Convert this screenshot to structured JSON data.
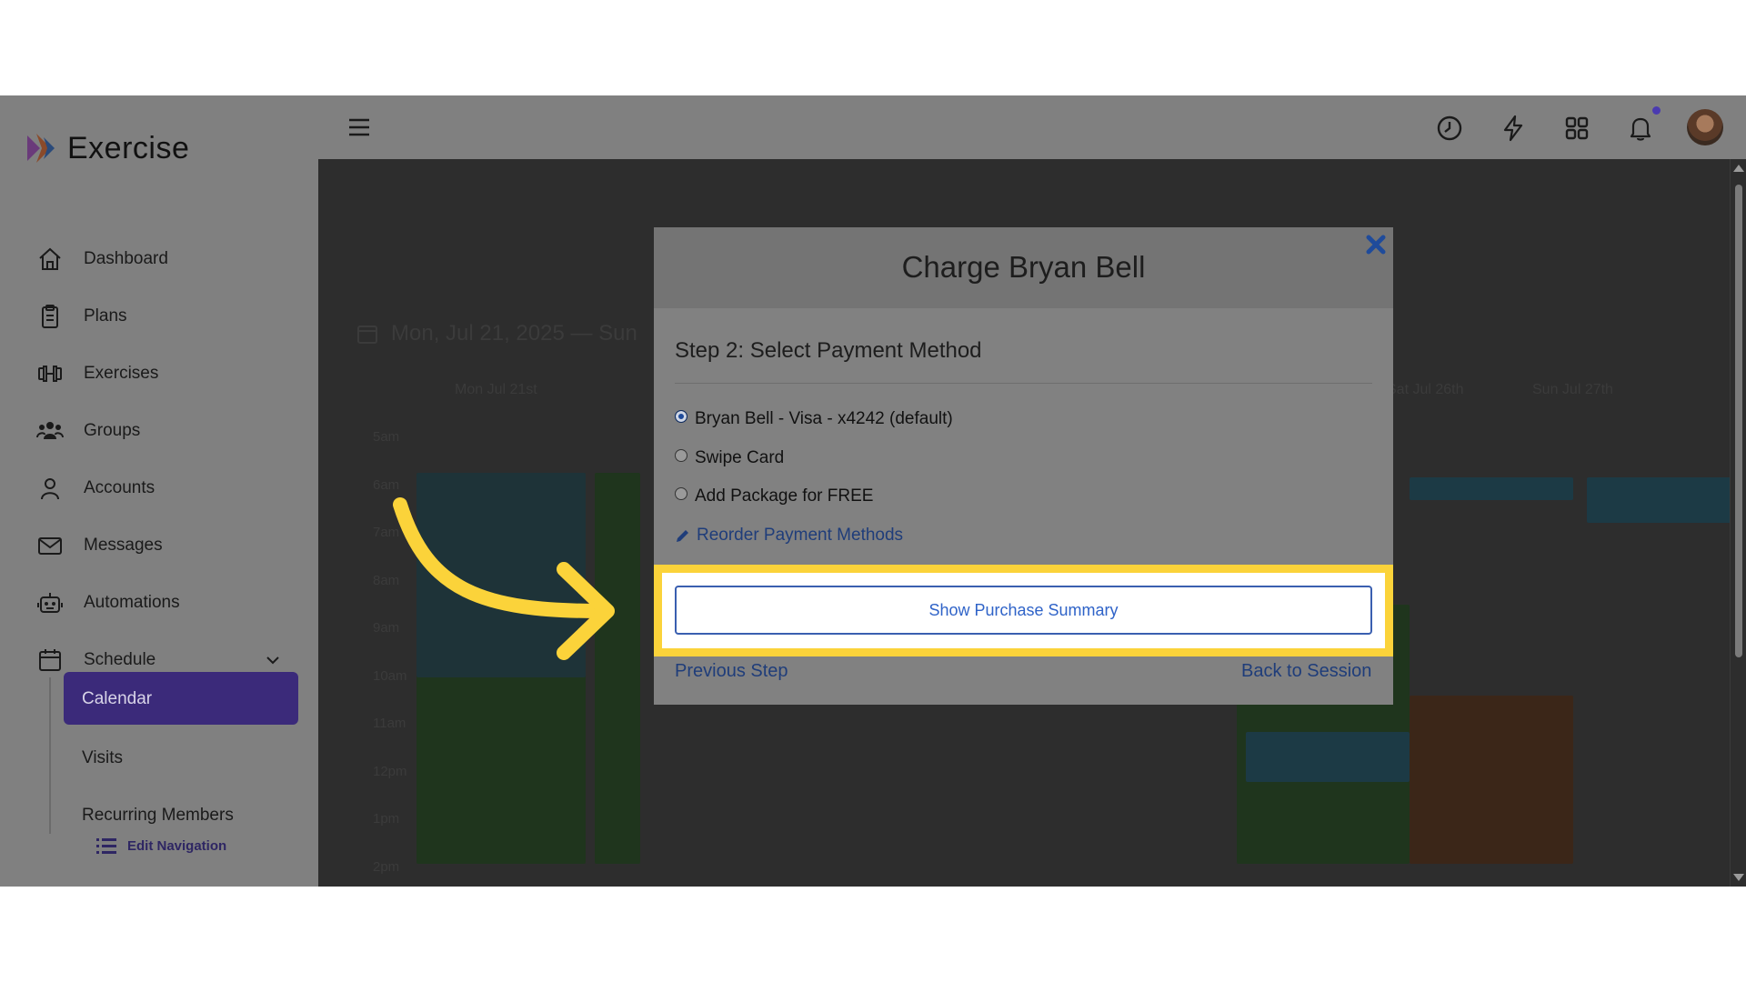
{
  "brand": {
    "name": "Exercise"
  },
  "sidebar": {
    "items": [
      {
        "label": "Dashboard",
        "icon": "home-icon"
      },
      {
        "label": "Plans",
        "icon": "clipboard-icon"
      },
      {
        "label": "Exercises",
        "icon": "dumbbell-icon"
      },
      {
        "label": "Groups",
        "icon": "users-icon"
      },
      {
        "label": "Accounts",
        "icon": "user-icon"
      },
      {
        "label": "Messages",
        "icon": "envelope-icon"
      },
      {
        "label": "Automations",
        "icon": "robot-icon"
      },
      {
        "label": "Schedule",
        "icon": "calendar-icon"
      }
    ],
    "sub_items": [
      {
        "label": "Calendar",
        "active": true
      },
      {
        "label": "Visits"
      },
      {
        "label": "Recurring Members"
      }
    ],
    "edit_navigation": "Edit Navigation"
  },
  "topbar": {
    "icons": [
      "menu-icon",
      "clock-icon",
      "bolt-icon",
      "apps-grid-icon",
      "bell-icon",
      "avatar"
    ]
  },
  "background": {
    "date_range": "Mon, Jul 21, 2025 — Sun",
    "col_first": "Mon Jul 21st",
    "col_sat": "Sat Jul 26th",
    "col_sun": "Sun Jul 27th",
    "hours": [
      "5am",
      "6am",
      "7am",
      "8am",
      "9am",
      "10am",
      "11am",
      "12pm",
      "1pm",
      "2pm"
    ]
  },
  "modal": {
    "title": "Charge Bryan Bell",
    "step_title": "Step 2: Select Payment Method",
    "options": [
      {
        "label": "Bryan Bell - Visa - x4242 (default)",
        "selected": true
      },
      {
        "label": "Swipe Card",
        "selected": false
      },
      {
        "label": "Add Package for FREE",
        "selected": false
      }
    ],
    "reorder_link": "Reorder Payment Methods",
    "summary_button": "Show Purchase Summary",
    "previous_step": "Previous Step",
    "back_to_session": "Back to Session"
  },
  "colors": {
    "highlight": "#fbd33a",
    "arrow": "#fbd33a",
    "accent": "#5b3fd6",
    "link": "#2f63c8"
  }
}
